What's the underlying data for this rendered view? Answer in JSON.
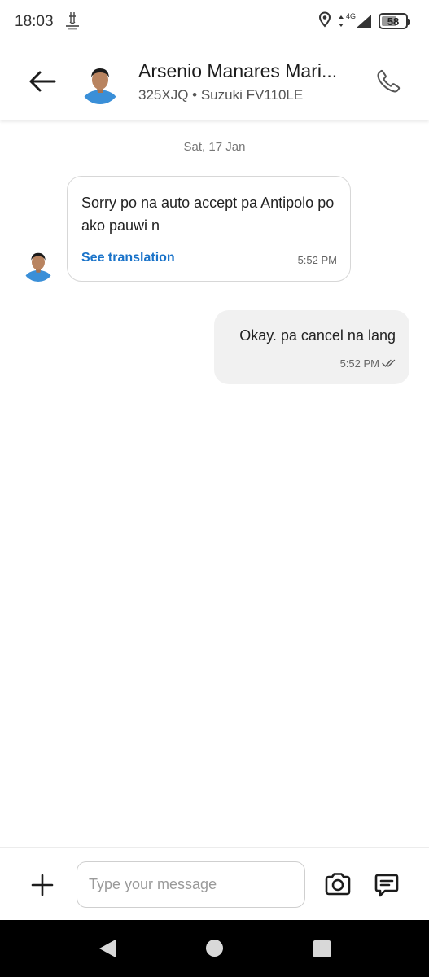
{
  "status_bar": {
    "time": "18:03",
    "network": "4G",
    "battery": "58",
    "icons": [
      "app-logo-icon",
      "location-icon",
      "signal-icon",
      "battery-icon"
    ]
  },
  "header": {
    "contact_name": "Arsenio Manares Mari...",
    "contact_sub": "325XJQ • Suzuki FV110LE",
    "icons": [
      "back-arrow-icon",
      "phone-icon"
    ]
  },
  "chat": {
    "date_divider": "Sat, 17 Jan",
    "messages": [
      {
        "direction": "incoming",
        "text": "Sorry po na auto accept pa Antipolo po ako pauwi n",
        "translation_link": "See translation",
        "time": "5:52 PM"
      },
      {
        "direction": "outgoing",
        "text": "Okay. pa cancel na lang",
        "time": "5:52 PM",
        "status": "read"
      }
    ]
  },
  "composer": {
    "placeholder": "Type your message",
    "value": "",
    "icons": [
      "plus-icon",
      "camera-icon",
      "quick-reply-icon"
    ]
  },
  "nav_bar": {
    "icons": [
      "nav-back-icon",
      "nav-home-icon",
      "nav-recents-icon"
    ]
  },
  "colors": {
    "link_blue": "#1a73c9",
    "avatar_shirt": "#3a8fd8",
    "outgoing_bubble": "#f1f1f1",
    "nav_bar": "#000000"
  }
}
